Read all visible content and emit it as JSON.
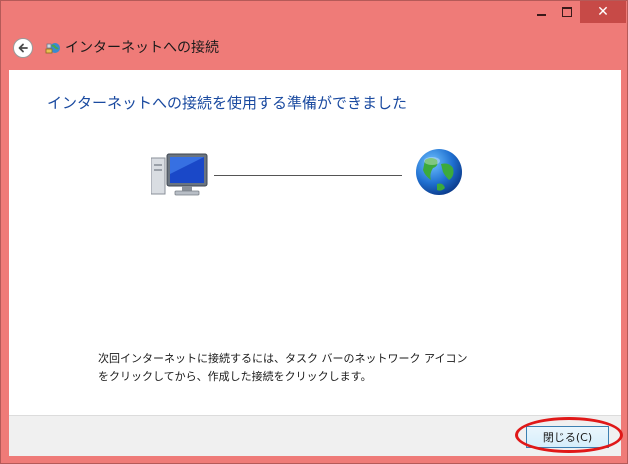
{
  "window": {
    "title": "インターネットへの接続",
    "minimize_glyph": "minimize-icon",
    "maximize_glyph": "maximize-icon",
    "close_glyph": "✕"
  },
  "main": {
    "heading": "インターネットへの接続を使用する準備ができました",
    "note": "次回インターネットに接続するには、タスク バーのネットワーク アイコンをクリックしてから、作成した接続をクリックします。"
  },
  "footer": {
    "close_label": "閉じる(C)"
  },
  "colors": {
    "window_frame": "#ef7b78",
    "heading": "#1a4aa0",
    "highlight": "#e01818"
  },
  "icons": [
    "back-arrow-icon",
    "network-connection-icon",
    "computer-icon",
    "globe-icon"
  ]
}
